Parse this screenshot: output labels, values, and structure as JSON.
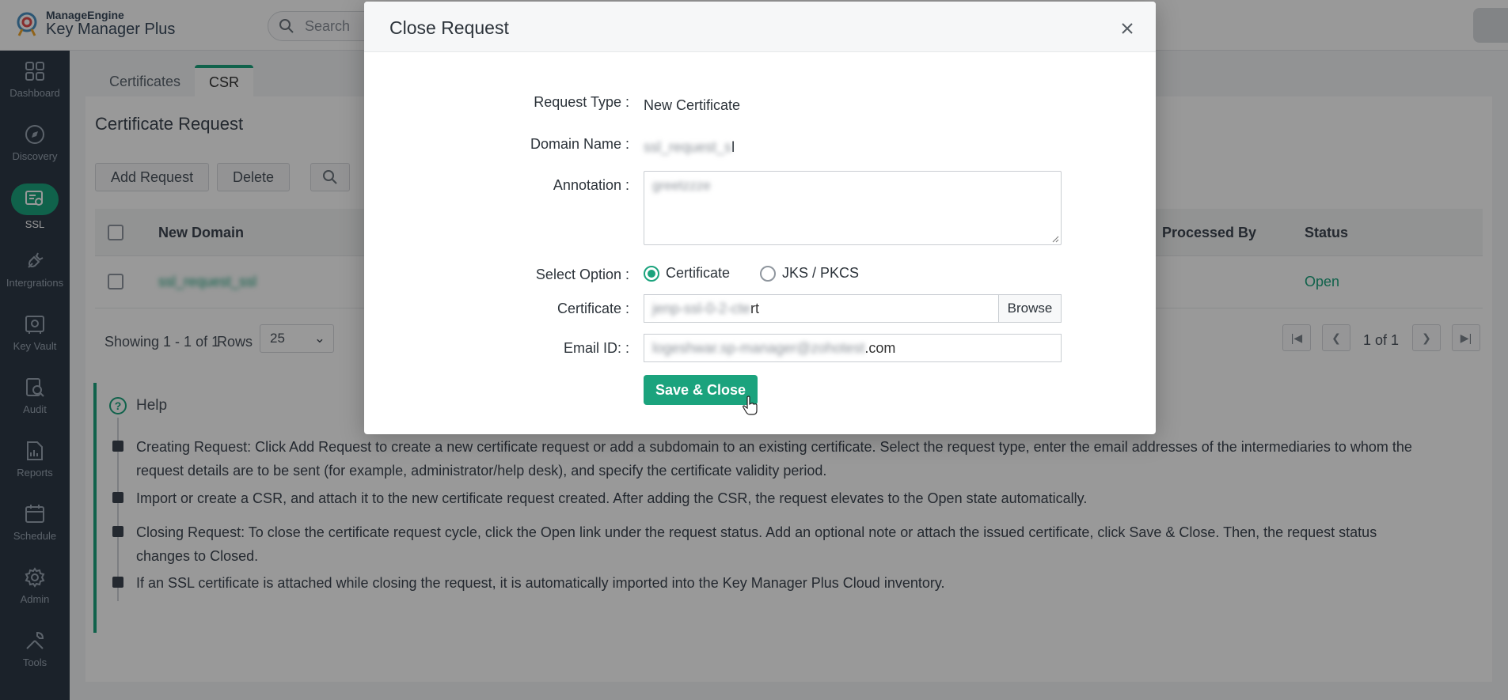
{
  "app": {
    "brand": "ManageEngine",
    "product": "Key Manager Plus",
    "search_placeholder": "Search"
  },
  "sidebar": {
    "items": [
      {
        "label": "Dashboard",
        "icon": "dashboard-icon"
      },
      {
        "label": "Discovery",
        "icon": "compass-icon"
      },
      {
        "label": "SSL",
        "icon": "certificate-icon",
        "active": true
      },
      {
        "label": "Intergrations",
        "icon": "plug-icon"
      },
      {
        "label": "Key Vault",
        "icon": "vault-icon"
      },
      {
        "label": "Audit",
        "icon": "audit-icon"
      },
      {
        "label": "Reports",
        "icon": "reports-icon"
      },
      {
        "label": "Schedule",
        "icon": "calendar-icon"
      },
      {
        "label": "Admin",
        "icon": "gear-icon"
      },
      {
        "label": "Tools",
        "icon": "tools-icon"
      }
    ]
  },
  "main": {
    "tabs": [
      {
        "label": "Certificates"
      },
      {
        "label": "CSR",
        "active": true
      }
    ],
    "page_title": "Certificate Request",
    "actions": {
      "add_request": "Add Request",
      "delete": "Delete"
    },
    "table": {
      "columns": [
        "New Domain",
        "Processed By",
        "Status"
      ],
      "rows": [
        {
          "domain": "ssl_request_ssl",
          "processed_by": "",
          "status": "Open"
        }
      ]
    },
    "pager": {
      "showing": "Showing 1 - 1 of 1",
      "rows_label": "Rows",
      "rows_value": "25",
      "page": "1 of 1"
    },
    "help": {
      "title": "Help",
      "items": [
        "Creating Request: Click Add Request to create a new certificate request or add a subdomain to an existing certificate. Select the request type, enter the email addresses of the intermediaries to whom the request details are to be sent (for example, administrator/help desk), and specify the certificate validity period.",
        "Import or create a CSR, and attach it to the new certificate request created. After adding the CSR, the request elevates to the Open state automatically.",
        "Closing Request: To close the certificate request cycle, click the Open link under the request status. Add an optional note or attach the issued certificate, click Save & Close. Then, the request status changes to Closed.",
        "If an SSL certificate is attached while closing the request, it is automatically imported into the Key Manager Plus Cloud inventory."
      ]
    }
  },
  "modal": {
    "title": "Close Request",
    "fields": {
      "request_type_label": "Request Type :",
      "request_type_value": "New Certificate",
      "domain_name_label": "Domain Name :",
      "domain_name_hidden": "ssl_request_s",
      "domain_name_tail": "l",
      "annotation_label": "Annotation :",
      "annotation_value": "greetzzze",
      "select_option_label": "Select Option :",
      "option_certificate": "Certificate",
      "option_jks": "JKS / PKCS",
      "certificate_label": "Certificate :",
      "certificate_hidden": "jenp-ssl-0-2-cte",
      "certificate_tail": "rt",
      "browse_label": "Browse",
      "email_label": "Email ID: :",
      "email_hidden": "logeshwar.sp-manager@zohotest",
      "email_tail": ".com"
    },
    "save_label": "Save & Close"
  },
  "colors": {
    "accent": "#1ba37d",
    "sidebar_bg": "#2e3a47",
    "overlay": "rgba(0,0,0,0.40)"
  }
}
